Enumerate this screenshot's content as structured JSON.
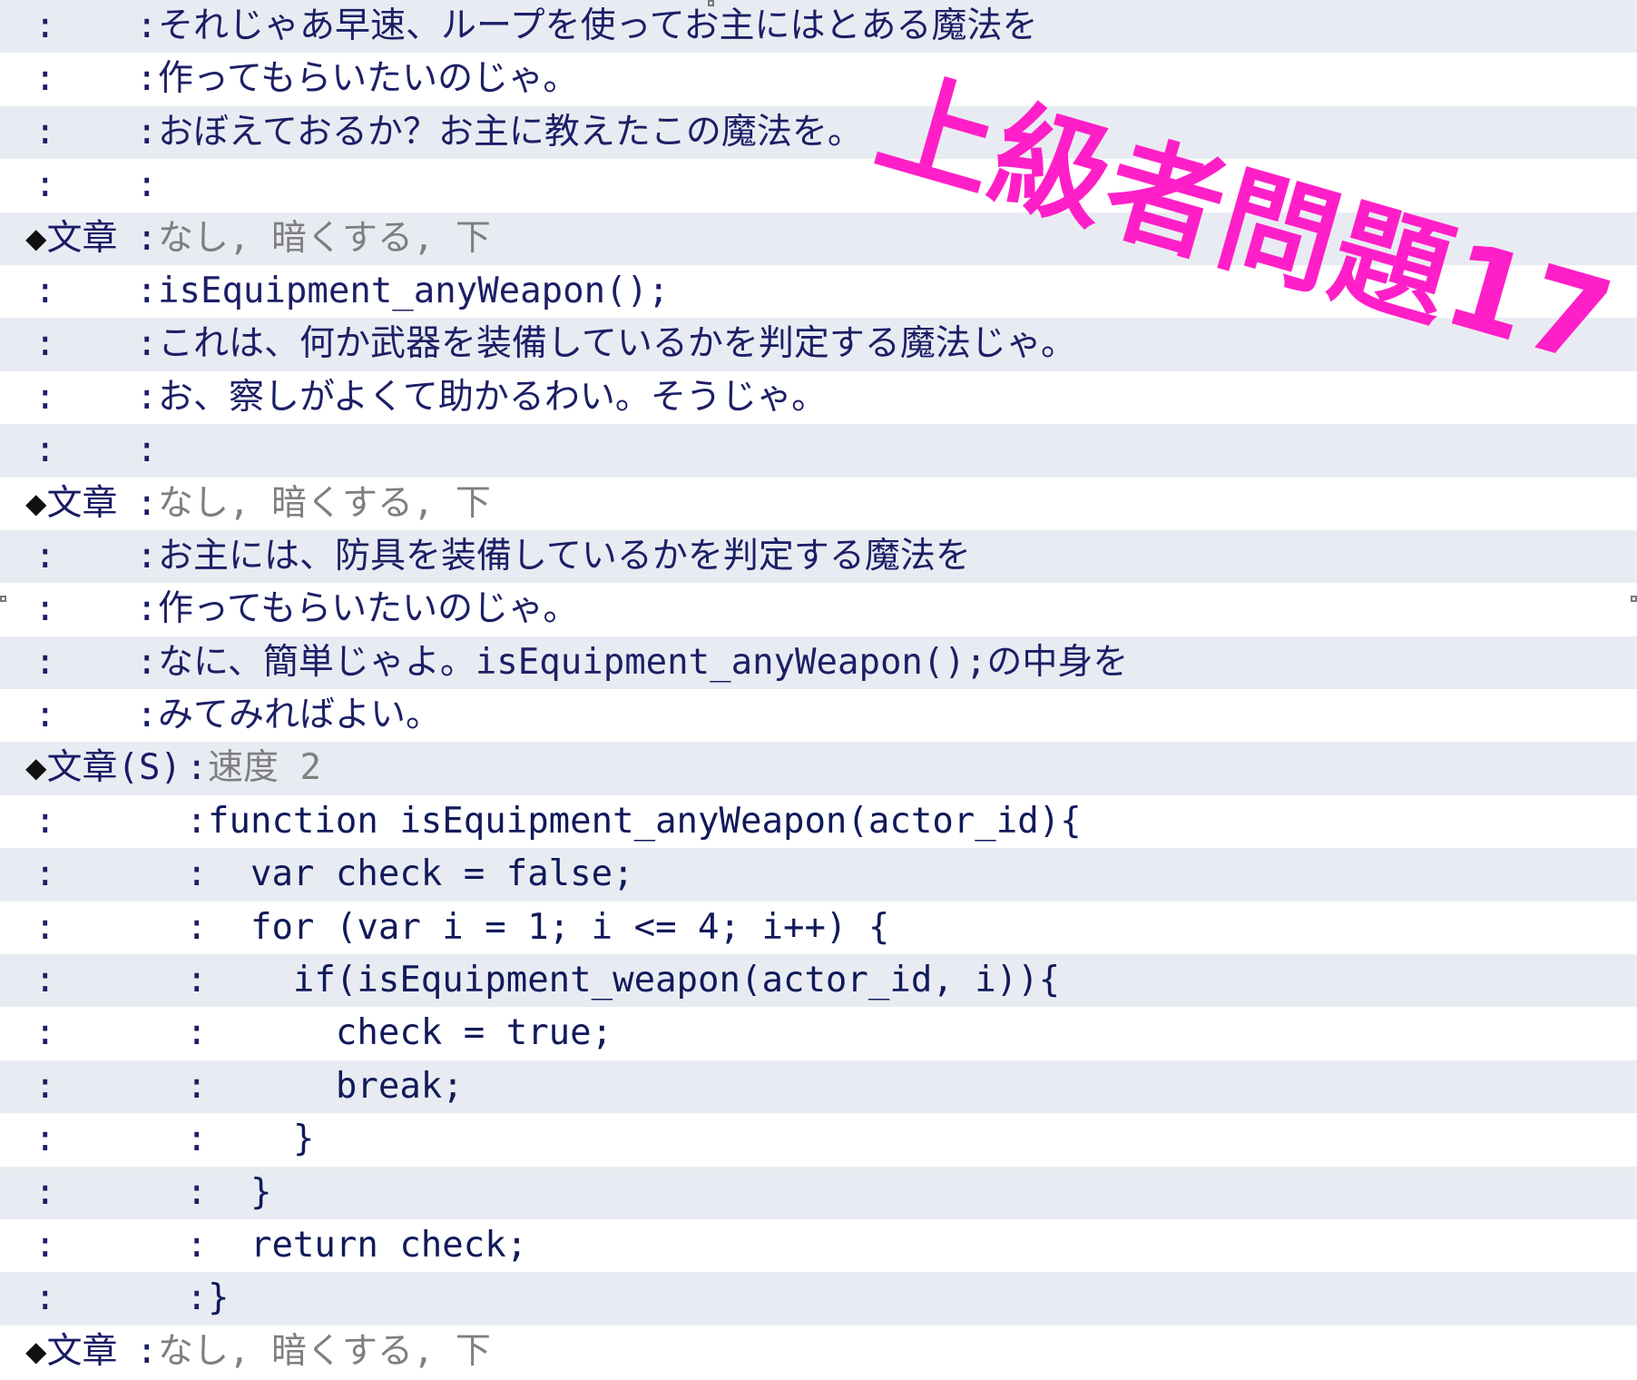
{
  "rows": [
    {
      "kind": "text",
      "col": ":",
      "sep_col": 150,
      "text": "それじゃあ早速、ループを使ってお主にはとある魔法を"
    },
    {
      "kind": "text",
      "col": ":",
      "sep_col": 150,
      "text": "作ってもらいたいのじゃ。"
    },
    {
      "kind": "text",
      "col": ":",
      "sep_col": 150,
      "text": "おぼえておるか？お主に教えたこの魔法を。"
    },
    {
      "kind": "text",
      "col": ":",
      "sep_col": 150,
      "text": ""
    },
    {
      "kind": "cmd",
      "diamond": "◆",
      "command": "文章",
      "sep_col": 150,
      "text": "なし, 暗くする, 下"
    },
    {
      "kind": "text",
      "col": ":",
      "sep_col": 150,
      "text": "isEquipment_anyWeapon();"
    },
    {
      "kind": "text",
      "col": ":",
      "sep_col": 150,
      "text": "これは、何か武器を装備しているかを判定する魔法じゃ。"
    },
    {
      "kind": "text",
      "col": ":",
      "sep_col": 150,
      "text": "お、察しがよくて助かるわい。そうじゃ。"
    },
    {
      "kind": "text",
      "col": ":",
      "sep_col": 150,
      "text": ""
    },
    {
      "kind": "cmd",
      "diamond": "◆",
      "command": "文章",
      "sep_col": 150,
      "text": "なし, 暗くする, 下"
    },
    {
      "kind": "text",
      "col": ":",
      "sep_col": 150,
      "text": "お主には、防具を装備しているかを判定する魔法を"
    },
    {
      "kind": "text",
      "col": ":",
      "sep_col": 150,
      "text": "作ってもらいたいのじゃ。"
    },
    {
      "kind": "text",
      "col": ":",
      "sep_col": 150,
      "text": "なに、簡単じゃよ。isEquipment_anyWeapon();の中身を"
    },
    {
      "kind": "text",
      "col": ":",
      "sep_col": 150,
      "text": "みてみればよい。"
    },
    {
      "kind": "cmd",
      "diamond": "◆",
      "command": "文章(S)",
      "sep_col": 205,
      "text": "速度 2"
    },
    {
      "kind": "code",
      "col": ":",
      "sep_col": 205,
      "text": "function isEquipment_anyWeapon(actor_id){"
    },
    {
      "kind": "code",
      "col": ":",
      "sep_col": 205,
      "text": "  var check = false;"
    },
    {
      "kind": "code",
      "col": ":",
      "sep_col": 205,
      "text": "  for (var i = 1; i <= 4; i++) {"
    },
    {
      "kind": "code",
      "col": ":",
      "sep_col": 205,
      "text": "    if(isEquipment_weapon(actor_id, i)){"
    },
    {
      "kind": "code",
      "col": ":",
      "sep_col": 205,
      "text": "      check = true;"
    },
    {
      "kind": "code",
      "col": ":",
      "sep_col": 205,
      "text": "      break;"
    },
    {
      "kind": "code",
      "col": ":",
      "sep_col": 205,
      "text": "    }"
    },
    {
      "kind": "code",
      "col": ":",
      "sep_col": 205,
      "text": "  }"
    },
    {
      "kind": "code",
      "col": ":",
      "sep_col": 205,
      "text": "  return check;"
    },
    {
      "kind": "code",
      "col": ":",
      "sep_col": 205,
      "text": "}"
    },
    {
      "kind": "cmd",
      "diamond": "◆",
      "command": "文章",
      "sep_col": 150,
      "text": "なし, 暗くする, 下"
    }
  ],
  "separator": ":",
  "overlay": {
    "title": "上級者問題17",
    "color": "#ff1fc8"
  },
  "colors": {
    "row_alt": "#e8ecf2",
    "text": "#1c1f66",
    "dim": "#7f7f7f"
  }
}
